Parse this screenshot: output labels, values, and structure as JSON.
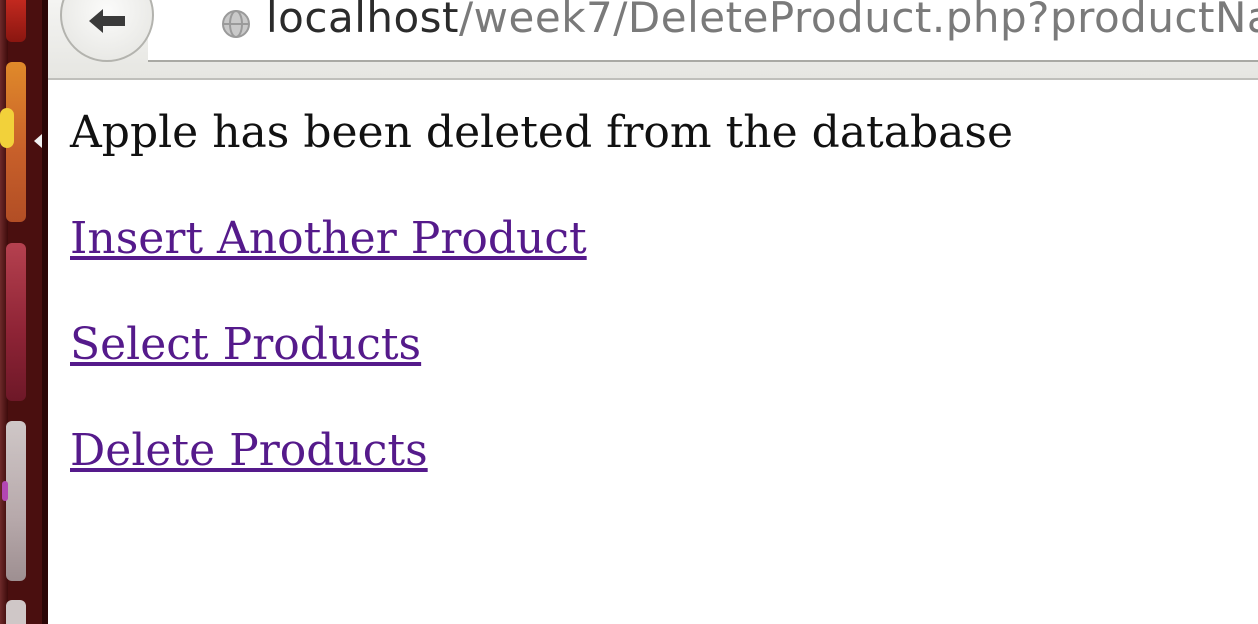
{
  "browser": {
    "url": {
      "host": "localhost",
      "path": "/week7/DeleteProduct.php?productNa"
    }
  },
  "page": {
    "message": "Apple has been deleted from the database",
    "links": [
      {
        "label": "Insert Another Product"
      },
      {
        "label": "Select Products"
      },
      {
        "label": "Delete Products"
      }
    ],
    "link_color": "#551a8b"
  },
  "launcher": {
    "icons": [
      "app-icon",
      "app-icon",
      "app-icon",
      "app-icon",
      "app-icon"
    ]
  }
}
